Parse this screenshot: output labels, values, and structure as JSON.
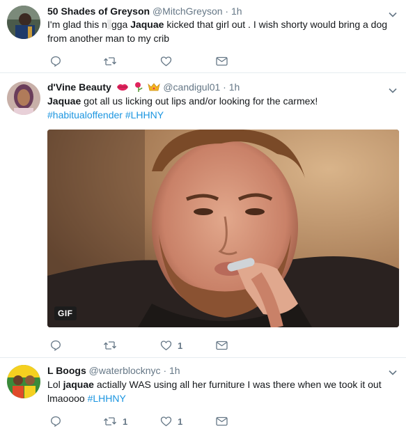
{
  "tweets": [
    {
      "name": "50 Shades of Greyson",
      "handle": "@MitchGreyson",
      "dot": "·",
      "time": "1h",
      "text_pre": "I'm glad this n",
      "text_censored": "  ",
      "text_mid": "gga ",
      "text_bold": "Jaquae",
      "text_post": " kicked that girl out . I wish shorty would bring a dog from another man to my crib",
      "reply_count": "",
      "retweet_count": "",
      "like_count": ""
    },
    {
      "name": "d'Vine Beauty",
      "handle": "@candigul01",
      "dot": "·",
      "time": "1h",
      "text_bold": "Jaquae",
      "text_post": " got all us licking out lips and/or looking for the carmex!",
      "hashtag1": "#habitualoffender",
      "hashtag2": "#LHHNY",
      "gif_label": "GIF",
      "reply_count": "",
      "retweet_count": "",
      "like_count": "1"
    },
    {
      "name": "L Boogs",
      "handle": "@waterblocknyc",
      "dot": "·",
      "time": "1h",
      "text_pre": "Lol ",
      "text_bold": "jaquae",
      "text_post": " actially WAS using all her furniture I was there when we took it out lmaoooo ",
      "hashtag1": "#LHHNY",
      "reply_count": "",
      "retweet_count": "1",
      "like_count": "1"
    }
  ],
  "icons": {
    "reply": "reply-icon",
    "retweet": "retweet-icon",
    "like": "heart-icon",
    "dm": "envelope-icon",
    "caret": "chevron-down-icon"
  },
  "colors": {
    "hashtag": "#1b95e0",
    "muted": "#657786",
    "divider": "#e6ecf0"
  }
}
